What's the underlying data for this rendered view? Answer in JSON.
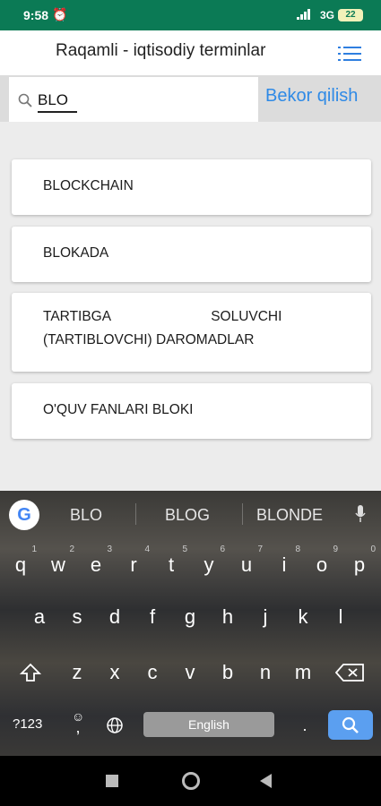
{
  "status_bar": {
    "time": "9:58",
    "network": "3G",
    "battery": "22"
  },
  "header": {
    "title": "Raqamli - iqtisodiy terminlar",
    "menu_icon": "list-menu-icon"
  },
  "search": {
    "value": "BLO",
    "cancel_label": "Bekor qilish",
    "icon": "search-icon"
  },
  "results": [
    {
      "label": "BLOCKCHAIN"
    },
    {
      "label": "BLOKADA"
    },
    {
      "label": "TARTIBGA                          SOLUVCHI\n(TARTIBLOVCHI) DAROMADLAR"
    },
    {
      "label": "O'QUV FANLARI BLOKI"
    }
  ],
  "keyboard": {
    "suggestions": [
      "BLO",
      "BLOG",
      "BLONDE"
    ],
    "row1": [
      "q",
      "w",
      "e",
      "r",
      "t",
      "y",
      "u",
      "i",
      "o",
      "p"
    ],
    "row1_hints": [
      "1",
      "2",
      "3",
      "4",
      "5",
      "6",
      "7",
      "8",
      "9",
      "0"
    ],
    "row2": [
      "a",
      "s",
      "d",
      "f",
      "g",
      "h",
      "j",
      "k",
      "l"
    ],
    "row3": [
      "z",
      "x",
      "c",
      "v",
      "b",
      "n",
      "m"
    ],
    "symbols_label": "?123",
    "comma_label": ",",
    "period_label": ".",
    "space_label": "English"
  },
  "colors": {
    "status_bar": "#0b7a55",
    "accent": "#2f8ae6",
    "search_key": "#5b9ff0"
  }
}
